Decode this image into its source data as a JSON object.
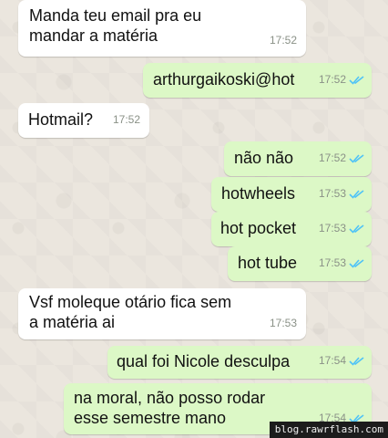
{
  "chat": {
    "messages": [
      {
        "dir": "in",
        "text": "Manda teu email pra eu\nmandar a matéria",
        "time": "17:52",
        "read": false
      },
      {
        "dir": "out",
        "text": "arthurgaikoski@hot",
        "time": "17:52",
        "read": true
      },
      {
        "dir": "in",
        "text": "Hotmail?",
        "time": "17:52",
        "read": false
      },
      {
        "dir": "out",
        "text": "não não",
        "time": "17:52",
        "read": true
      },
      {
        "dir": "out",
        "text": "hotwheels",
        "time": "17:53",
        "read": true
      },
      {
        "dir": "out",
        "text": "hot pocket",
        "time": "17:53",
        "read": true
      },
      {
        "dir": "out",
        "text": "hot tube",
        "time": "17:53",
        "read": true
      },
      {
        "dir": "in",
        "text": "Vsf moleque otário fica sem\na matéria ai",
        "time": "17:53",
        "read": false
      },
      {
        "dir": "out",
        "text": "qual foi Nicole desculpa",
        "time": "17:54",
        "read": true
      },
      {
        "dir": "out",
        "text": "na moral, não posso rodar\nesse semestre mano",
        "time": "17:54",
        "read": true
      }
    ]
  },
  "watermark": "blog.rawrflash.com",
  "colors": {
    "incoming": "#ffffff",
    "outgoing": "#dcf8c6",
    "read_ticks": "#4fc3f7",
    "wallpaper": "#ebe6de"
  }
}
